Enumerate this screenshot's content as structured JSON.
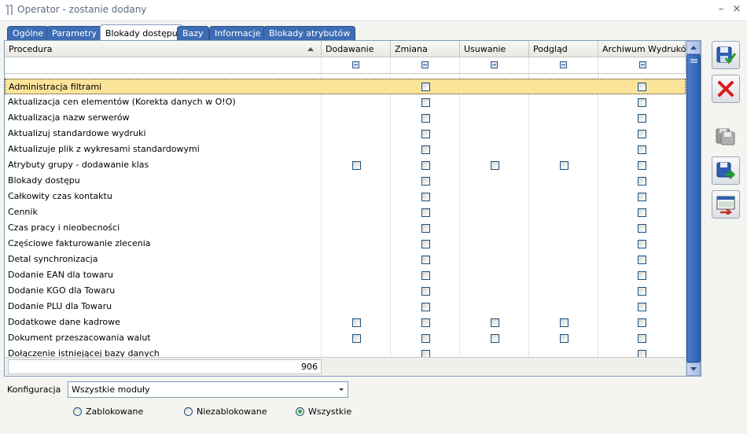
{
  "window": {
    "title": "Operator - zostanie dodany",
    "minimize_label": "–",
    "close_label": "×"
  },
  "tabs": [
    {
      "label": "Ogólne",
      "active": false
    },
    {
      "label": "Parametry",
      "active": false
    },
    {
      "label": "Blokady dostępu",
      "active": true
    },
    {
      "label": "Bazy",
      "active": false
    },
    {
      "label": "Informacje",
      "active": false
    },
    {
      "label": "Blokady atrybutów",
      "active": false
    }
  ],
  "grid": {
    "columns": [
      "Procedura",
      "Dodawanie",
      "Zmiana",
      "Usuwanie",
      "Podgląd",
      "Archiwum Wydruków"
    ],
    "sort_column": "Procedura",
    "sort_direction": "ascending",
    "rows": [
      {
        "name": "Administracja filtrami",
        "cells": [
          false,
          true,
          false,
          false,
          true
        ],
        "selected": true
      },
      {
        "name": "Aktualizacja cen elementów (Korekta danych w O!O)",
        "cells": [
          false,
          true,
          false,
          false,
          true
        ]
      },
      {
        "name": "Aktualizacja nazw serwerów",
        "cells": [
          false,
          true,
          false,
          false,
          true
        ]
      },
      {
        "name": "Aktualizuj standardowe wydruki",
        "cells": [
          false,
          true,
          false,
          false,
          true
        ]
      },
      {
        "name": "Aktualizuje plik z wykresami standardowymi",
        "cells": [
          false,
          true,
          false,
          false,
          true
        ]
      },
      {
        "name": "Atrybuty grupy - dodawanie klas",
        "cells": [
          true,
          true,
          true,
          true,
          true
        ]
      },
      {
        "name": "Blokady dostępu",
        "cells": [
          false,
          true,
          false,
          false,
          true
        ]
      },
      {
        "name": "Całkowity czas kontaktu",
        "cells": [
          false,
          true,
          false,
          false,
          true
        ]
      },
      {
        "name": "Cennik",
        "cells": [
          false,
          true,
          false,
          false,
          true
        ]
      },
      {
        "name": "Czas pracy i nieobecności",
        "cells": [
          false,
          true,
          false,
          false,
          true
        ]
      },
      {
        "name": "Częściowe fakturowanie zlecenia",
        "cells": [
          false,
          true,
          false,
          false,
          true
        ]
      },
      {
        "name": "Detal synchronizacja",
        "cells": [
          false,
          true,
          false,
          false,
          true
        ]
      },
      {
        "name": "Dodanie EAN dla towaru",
        "cells": [
          false,
          true,
          false,
          false,
          true
        ]
      },
      {
        "name": "Dodanie KGO dla Towaru",
        "cells": [
          false,
          true,
          false,
          false,
          true
        ]
      },
      {
        "name": "Dodanie PLU dla Towaru",
        "cells": [
          false,
          true,
          false,
          false,
          true
        ]
      },
      {
        "name": "Dodatkowe dane kadrowe",
        "cells": [
          true,
          true,
          true,
          true,
          true
        ]
      },
      {
        "name": "Dokument przeszacowania walut",
        "cells": [
          true,
          true,
          true,
          true,
          true
        ]
      },
      {
        "name": "Dołączenie istniejącej bazy danych",
        "cells": [
          false,
          true,
          false,
          false,
          true
        ]
      }
    ],
    "footer_count": "906"
  },
  "config": {
    "label": "Konfiguracja",
    "value": "Wszystkie moduły"
  },
  "filter_radios": [
    {
      "label": "Zablokowane",
      "checked": false
    },
    {
      "label": "Niezablokowane",
      "checked": false
    },
    {
      "label": "Wszystkie",
      "checked": true
    }
  ],
  "toolbar_icons": [
    "save-check-icon",
    "cancel-x-icon",
    "save-disabled-icon",
    "save-arrow-icon",
    "export-icon"
  ],
  "colors": {
    "selected_row": "#fbe39a",
    "tab_active_bg": "#fdfdfd",
    "tab_bg": "#3e6db5",
    "scrollbar": "#2d5fb2"
  }
}
